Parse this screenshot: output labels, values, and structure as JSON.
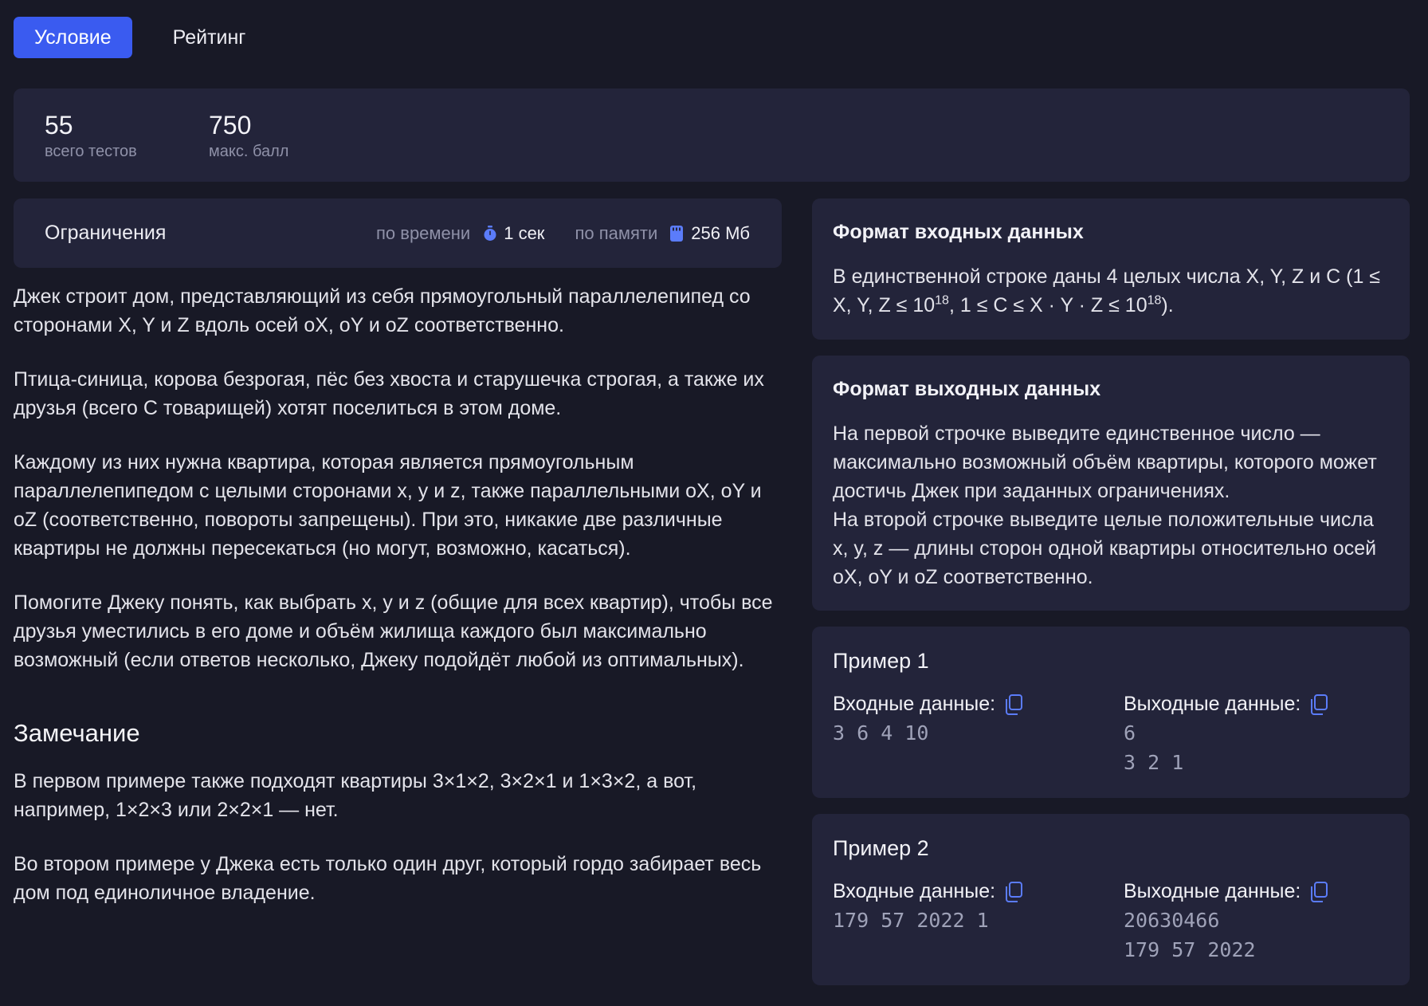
{
  "tabs": {
    "statement": "Условие",
    "rating": "Рейтинг"
  },
  "stats": {
    "total_tests": "55",
    "total_tests_label": "всего тестов",
    "max_score": "750",
    "max_score_label": "макс. балл"
  },
  "limits": {
    "title": "Ограничения",
    "time_label": "по времени",
    "time_value": "1 сек",
    "memory_label": "по памяти",
    "memory_value": "256 Мб"
  },
  "statement": {
    "p1": "Джек строит дом, представляющий из себя прямоугольный параллелепипед со сторонами X, Y и Z вдоль осей oX, oY и oZ соответственно.",
    "p2": "Птица-синица, корова безрогая, пёс без хвоста и старушечка строгая, а также их друзья (всего C товарищей) хотят поселиться в этом доме.",
    "p3": "Каждому из них нужна квартира, которая является прямоугольным параллелепипедом с целыми сторонами x, y и z, также параллельными oX, oY и oZ (соответственно, повороты запрещены). При это, никакие две различные квартиры не должны пересекаться (но могут, возможно, касаться).",
    "p4": "Помогите Джеку понять, как выбрать x, y и z (общие для всех квартир), чтобы все друзья уместились в его доме и объём жилища каждого был максимально возможный (если ответов несколько, Джеку подойдёт любой из оптимальных).",
    "note_title": "Замечание",
    "note1": "В первом примере также подходят квартиры 3×1×2, 3×2×1 и 1×3×2, а вот, например, 1×2×3 или 2×2×1 — нет.",
    "note2": "Во втором примере у Джека есть только один друг, который гордо забирает весь дом под единоличное владение."
  },
  "input_format": {
    "title": "Формат входных данных",
    "text_a": "В единственной строке даны 4 целых числа X, Y, Z и C (1 ≤ X, Y, Z ≤ 10",
    "sup1": "18",
    "text_b": ", 1 ≤ C ≤ X · Y · Z ≤ 10",
    "sup2": "18",
    "text_c": ")."
  },
  "output_format": {
    "title": "Формат выходных данных",
    "line1": "На первой строчке выведите единственное число — максимально возможный объём квартиры, которого может достичь Джек при заданных ограничениях.",
    "line2": "На второй строчке выведите целые положительные числа x, y, z — длины сторон одной квартиры относительно осей oX, oY и oZ соответственно."
  },
  "examples": [
    {
      "title": "Пример 1",
      "input_label": "Входные данные:",
      "output_label": "Выходные данные:",
      "input": "3 6 4 10",
      "output": "6\n3 2 1"
    },
    {
      "title": "Пример 2",
      "input_label": "Входные данные:",
      "output_label": "Выходные данные:",
      "input": "179 57 2022 1",
      "output": "20630466\n179 57 2022"
    }
  ],
  "colors": {
    "accent": "#3a5bf0",
    "background": "#181926",
    "panel": "#23243a",
    "icon": "#5b7cfa"
  },
  "icons": {
    "time": "stopwatch-icon",
    "memory": "memory-card-icon",
    "copy": "copy-icon"
  }
}
